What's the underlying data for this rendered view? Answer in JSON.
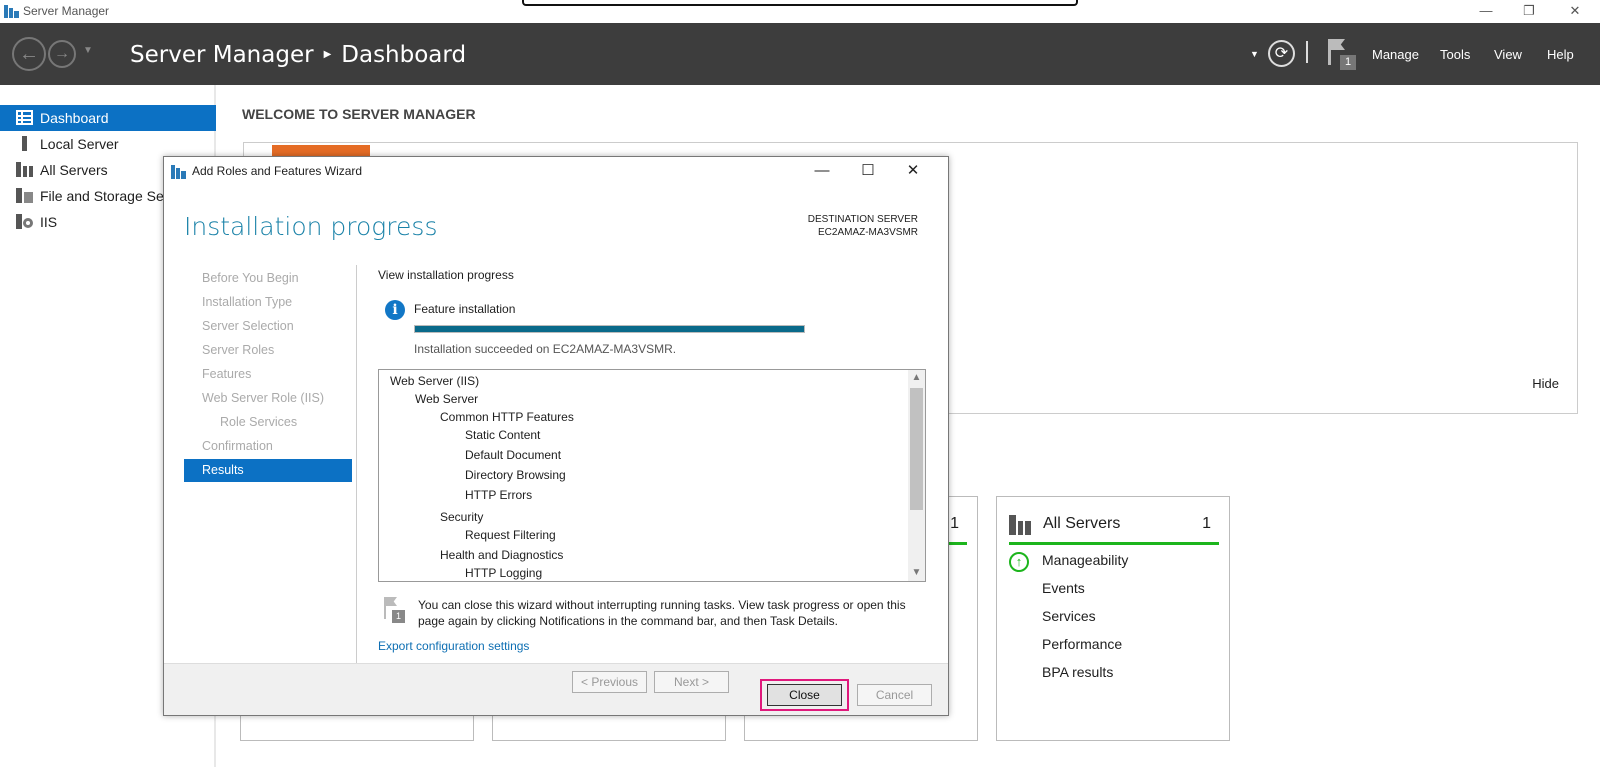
{
  "window": {
    "title": "Server Manager"
  },
  "commandbar": {
    "breadcrumb_app": "Server Manager",
    "breadcrumb_page": "Dashboard",
    "notification_count": "1",
    "menus": [
      "Manage",
      "Tools",
      "View",
      "Help"
    ]
  },
  "sidebar": {
    "items": [
      {
        "label": "Dashboard",
        "icon": "dashboard-icon",
        "active": true
      },
      {
        "label": "Local Server",
        "icon": "local-server-icon"
      },
      {
        "label": "All Servers",
        "icon": "all-servers-icon"
      },
      {
        "label": "File and Storage Services",
        "icon": "file-storage-icon"
      },
      {
        "label": "IIS",
        "icon": "iis-icon"
      }
    ]
  },
  "main": {
    "welcome": "WELCOME TO SERVER MANAGER",
    "hide_label": "Hide",
    "tiles": [
      {
        "title": "",
        "count": "1"
      },
      {
        "title": "All Servers",
        "count": "1",
        "rows": [
          "Manageability",
          "Events",
          "Services",
          "Performance",
          "BPA results"
        ]
      }
    ]
  },
  "wizard": {
    "title": "Add Roles and Features Wizard",
    "heading": "Installation progress",
    "destination_label": "DESTINATION SERVER",
    "destination_server": "EC2AMAZ-MA3VSMR",
    "steps": [
      "Before You Begin",
      "Installation Type",
      "Server Selection",
      "Server Roles",
      "Features",
      "Web Server Role (IIS)",
      "Role Services",
      "Confirmation",
      "Results"
    ],
    "active_step": "Results",
    "view_progress": "View installation progress",
    "feature_label": "Feature installation",
    "progress": 1.0,
    "status": "Installation succeeded on EC2AMAZ-MA3VSMR.",
    "features": [
      {
        "text": "Web Server (IIS)",
        "level": 0
      },
      {
        "text": "Web Server",
        "level": 1
      },
      {
        "text": "Common HTTP Features",
        "level": 2
      },
      {
        "text": "Static Content",
        "level": 3
      },
      {
        "text": "Default Document",
        "level": 3
      },
      {
        "text": "Directory Browsing",
        "level": 3
      },
      {
        "text": "HTTP Errors",
        "level": 3
      },
      {
        "text": "Security",
        "level": 2
      },
      {
        "text": "Request Filtering",
        "level": 3
      },
      {
        "text": "Health and Diagnostics",
        "level": 2
      },
      {
        "text": "HTTP Logging",
        "level": 3
      }
    ],
    "note_badge": "1",
    "note": "You can close this wizard without interrupting running tasks. View task progress or open this page again by clicking Notifications in the command bar, and then Task Details.",
    "export_link": "Export configuration settings",
    "buttons": {
      "previous": "< Previous",
      "next": "Next >",
      "close": "Close",
      "cancel": "Cancel"
    }
  },
  "colors": {
    "accent": "#0c71c4",
    "heading": "#1a82a8",
    "progress": "#0a6a8a",
    "status_ok": "#1db51d",
    "highlight": "#e0197c",
    "orange": "#e56c25"
  }
}
